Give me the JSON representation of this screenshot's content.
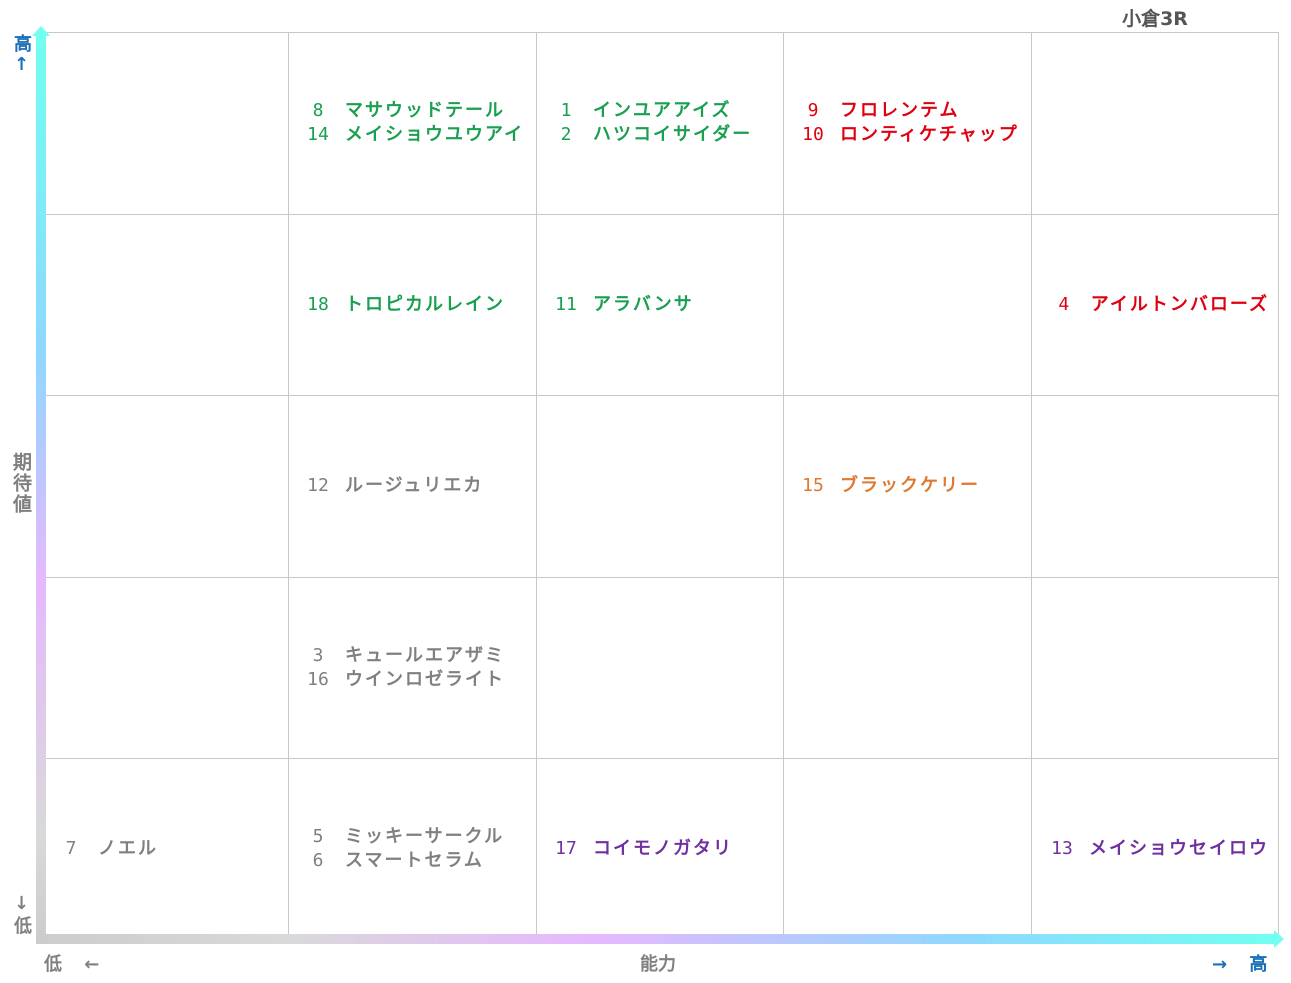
{
  "title": "小倉3R",
  "colors": {
    "green": "#18a050",
    "red": "#e00010",
    "gray": "#808080",
    "orange": "#e07830",
    "purple": "#7030a0",
    "axis_label_blue": "#1a6fb8",
    "axis_label_gray": "#808080"
  },
  "axes": {
    "y_title": "期待値",
    "y_high": "高↑",
    "y_low": "↓低",
    "x_title": "能力",
    "x_low": "低 ←",
    "x_high": "→ 高"
  },
  "chart_data": {
    "type": "table",
    "x_axis": "能力",
    "y_axis": "期待値",
    "columns": 5,
    "rows": 5,
    "cells": [
      {
        "col": 1,
        "row": 0,
        "color": "green",
        "entries": [
          {
            "num": "8",
            "name": "マサウッドテール"
          },
          {
            "num": "14",
            "name": "メイショウユウアイ"
          }
        ]
      },
      {
        "col": 2,
        "row": 0,
        "color": "green",
        "entries": [
          {
            "num": "1",
            "name": "インユアアイズ"
          },
          {
            "num": "2",
            "name": "ハツコイサイダー"
          }
        ]
      },
      {
        "col": 3,
        "row": 0,
        "color": "red",
        "entries": [
          {
            "num": "9",
            "name": "フロレンテム"
          },
          {
            "num": "10",
            "name": "ロンティケチャップ"
          }
        ]
      },
      {
        "col": 1,
        "row": 1,
        "color": "green",
        "entries": [
          {
            "num": "18",
            "name": "トロピカルレイン"
          }
        ]
      },
      {
        "col": 2,
        "row": 1,
        "color": "green",
        "entries": [
          {
            "num": "11",
            "name": "アラバンサ"
          }
        ]
      },
      {
        "col": 4,
        "row": 1,
        "color": "red",
        "align": "right",
        "entries": [
          {
            "num": "4",
            "name": "アイルトンバローズ"
          }
        ]
      },
      {
        "col": 1,
        "row": 2,
        "color": "gray",
        "entries": [
          {
            "num": "12",
            "name": "ルージュリエカ"
          }
        ]
      },
      {
        "col": 3,
        "row": 2,
        "color": "orange",
        "entries": [
          {
            "num": "15",
            "name": "ブラックケリー"
          }
        ]
      },
      {
        "col": 1,
        "row": 3,
        "color": "gray",
        "entries": [
          {
            "num": "3",
            "name": "キュールエアザミ"
          },
          {
            "num": "16",
            "name": "ウインロゼライト"
          }
        ]
      },
      {
        "col": 0,
        "row": 4,
        "color": "gray",
        "entries": [
          {
            "num": "7",
            "name": "ノエル"
          }
        ]
      },
      {
        "col": 1,
        "row": 4,
        "color": "gray",
        "entries": [
          {
            "num": "5",
            "name": "ミッキーサークル"
          },
          {
            "num": "6",
            "name": "スマートセラム"
          }
        ]
      },
      {
        "col": 2,
        "row": 4,
        "color": "purple",
        "entries": [
          {
            "num": "17",
            "name": "コイモノガタリ"
          }
        ]
      },
      {
        "col": 4,
        "row": 4,
        "color": "purple",
        "align": "right",
        "entries": [
          {
            "num": "13",
            "name": "メイショウセイロウ"
          }
        ]
      }
    ]
  }
}
